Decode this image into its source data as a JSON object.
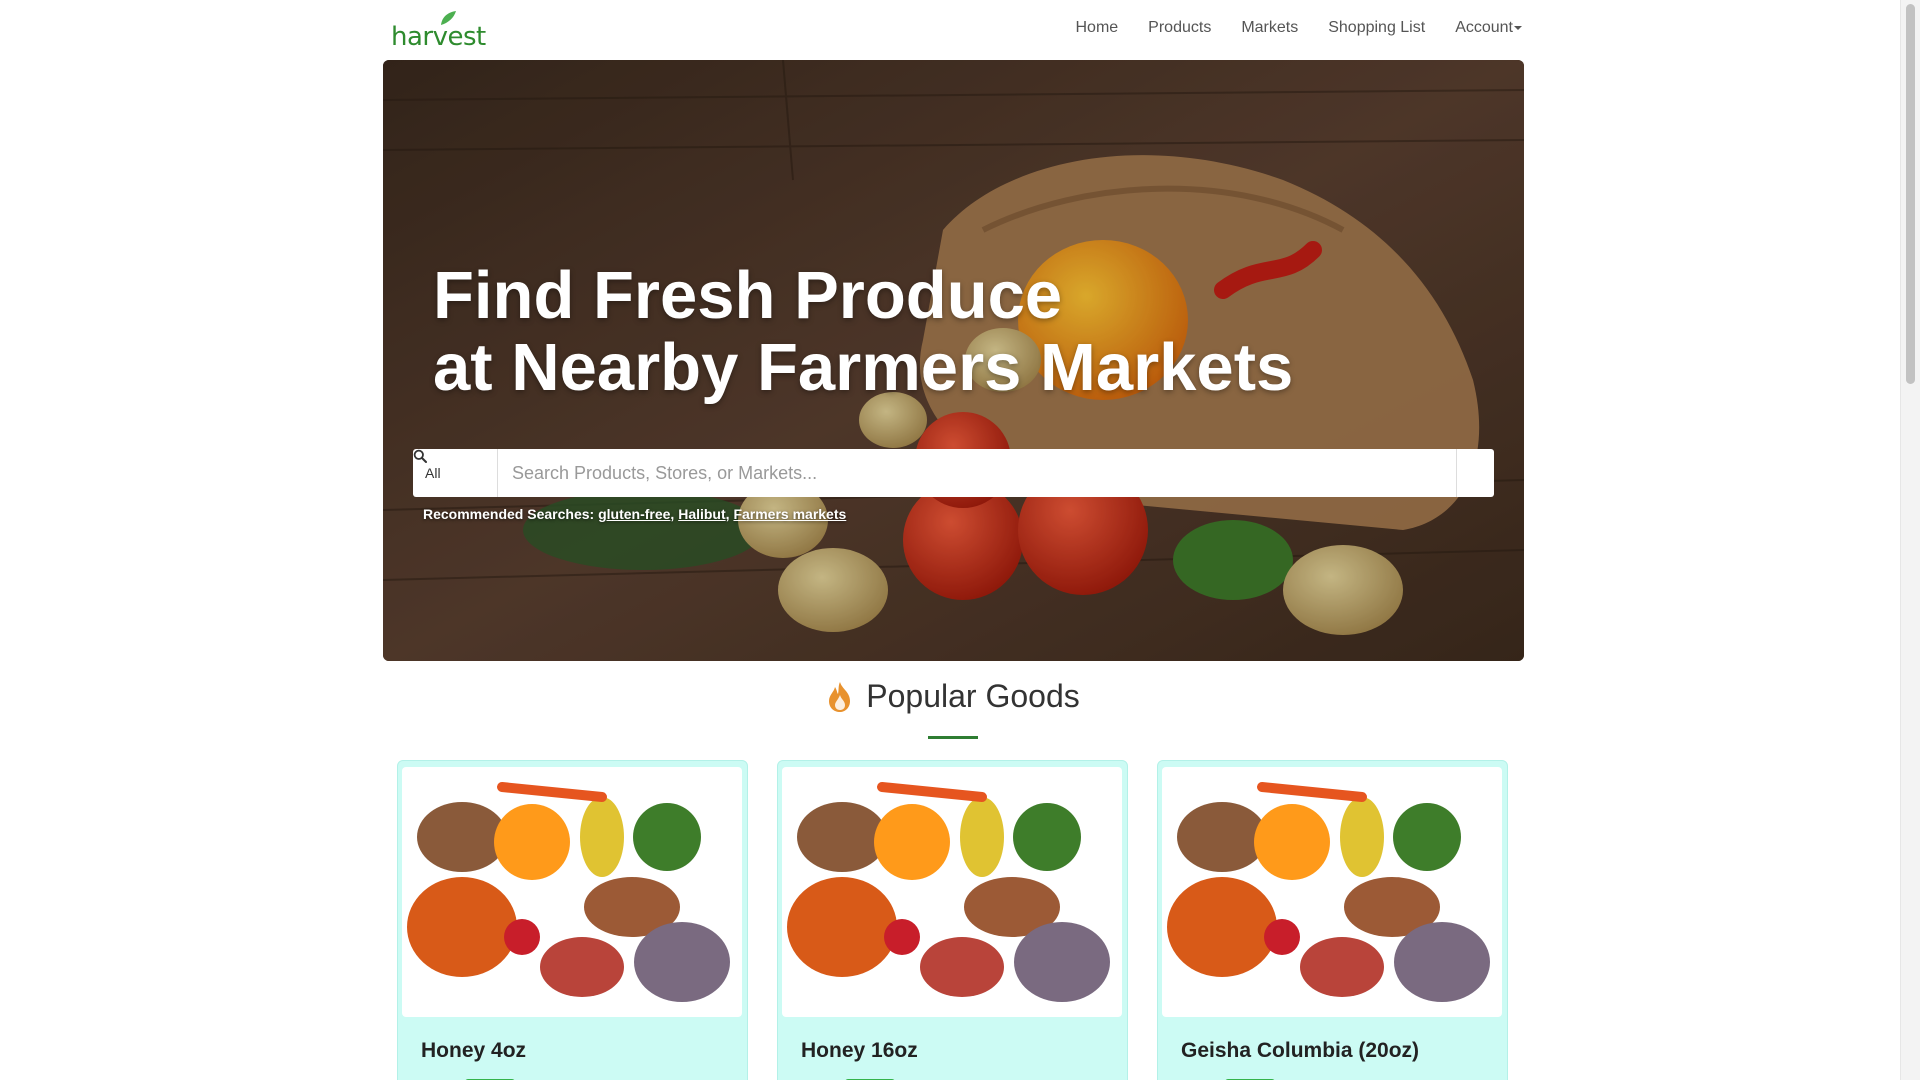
{
  "nav": {
    "logo": "harvest",
    "links": [
      "Home",
      "Products",
      "Markets",
      "Shopping List"
    ],
    "account": "Account"
  },
  "hero": {
    "title_line1": "Find Fresh Produce",
    "title_line2": "at Nearby Farmers Markets",
    "search": {
      "scope": "All",
      "placeholder": "Search Products, Stores, or Markets...",
      "button_icon": "search-icon"
    },
    "recommended_label": "Recommended Searches:",
    "recommended": [
      "gluten-free",
      "Halibut",
      "Farmers markets"
    ]
  },
  "popular": {
    "title": "Popular Goods",
    "icon": "fire-icon",
    "items": [
      {
        "name": "Honey 4oz"
      },
      {
        "name": "Honey 16oz"
      },
      {
        "name": "Geisha Columbia (20oz)"
      }
    ]
  },
  "colors": {
    "brand_green": "#2e8b2e",
    "card_bg": "#ccfbf4",
    "accent_orange": "#e8922e"
  }
}
